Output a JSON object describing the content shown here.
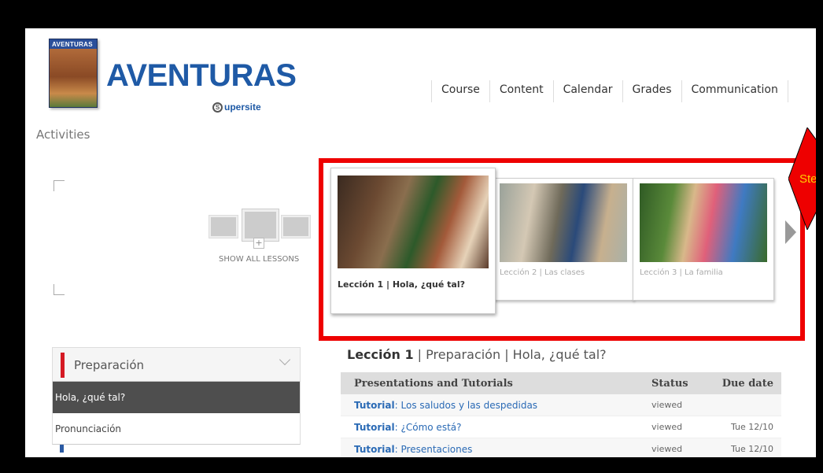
{
  "brand": {
    "book_label": "AVENTURAS",
    "title": "AVENTURAS",
    "subtitle_prefix": "S",
    "subtitle": "upersite"
  },
  "topnav": [
    "Course",
    "Content",
    "Calendar",
    "Grades",
    "Communication"
  ],
  "page_title": "Activities",
  "show_all_label": "SHOW ALL LESSONS",
  "lessons": [
    {
      "label": "Lección 1 | Hola, ¿qué tal?"
    },
    {
      "label": "Lección 2 | Las clases"
    },
    {
      "label": "Lección 3 | La familia"
    }
  ],
  "callout_text": "Ste",
  "sidebar": {
    "section_label": "Preparación",
    "items": [
      "Hola, ¿qué tal?",
      "Pronunciación"
    ]
  },
  "main": {
    "heading_lesson": "Lección 1",
    "heading_rest": " | Preparación | Hola, ¿qué tal?",
    "columns": [
      "Presentations and Tutorials",
      "Status",
      "Due date"
    ],
    "rows": [
      {
        "kind": "Tutorial",
        "title": ": Los saludos y las despedidas",
        "status": "viewed",
        "due": ""
      },
      {
        "kind": "Tutorial",
        "title": ": ¿Cómo está?",
        "status": "viewed",
        "due": "Tue 12/10"
      },
      {
        "kind": "Tutorial",
        "title": ": Presentaciones",
        "status": "viewed",
        "due": "Tue 12/10"
      }
    ]
  },
  "colors": {
    "brand_blue": "#1f5aa6",
    "highlight_red": "#ee0000",
    "accent_red": "#d51a24",
    "link_blue": "#2a6ab5"
  }
}
